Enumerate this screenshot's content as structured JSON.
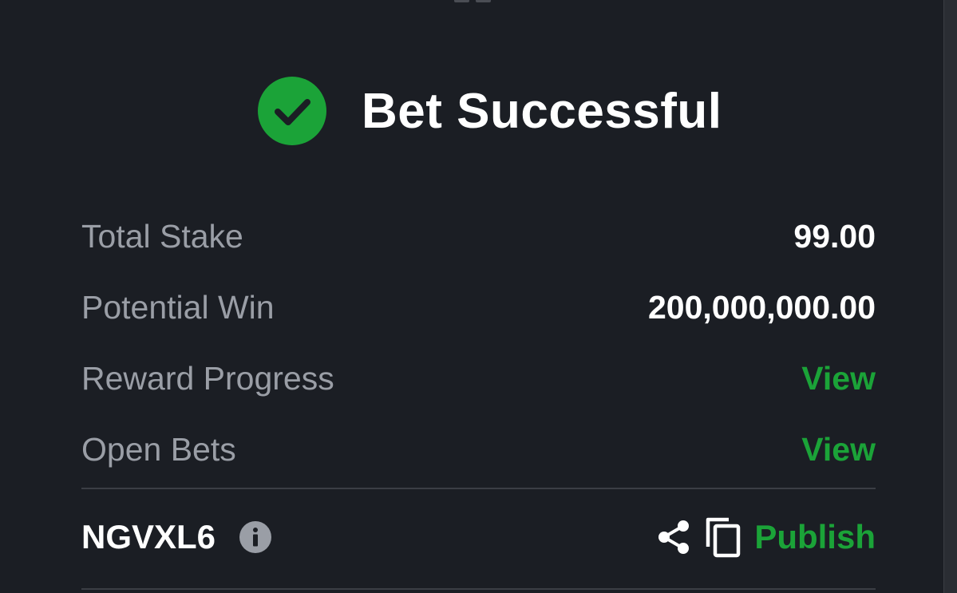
{
  "header": {
    "title": "Bet Successful"
  },
  "summary": {
    "rows": [
      {
        "label": "Total Stake",
        "value": "99.00"
      },
      {
        "label": "Potential Win",
        "value": "200,000,000.00"
      },
      {
        "label": "Reward Progress",
        "value": "View"
      },
      {
        "label": "Open Bets",
        "value": "View"
      }
    ]
  },
  "footer": {
    "booking_code": "NGVXL6",
    "publish_label": "Publish"
  },
  "icons": {
    "success": "check-circle-icon",
    "info": "info-icon",
    "share": "share-icon",
    "copy": "copy-icon"
  },
  "colors": {
    "background": "#1b1e24",
    "accent_green": "#1ba338",
    "label_gray": "#9a9ea6",
    "text_white": "#ffffff"
  }
}
